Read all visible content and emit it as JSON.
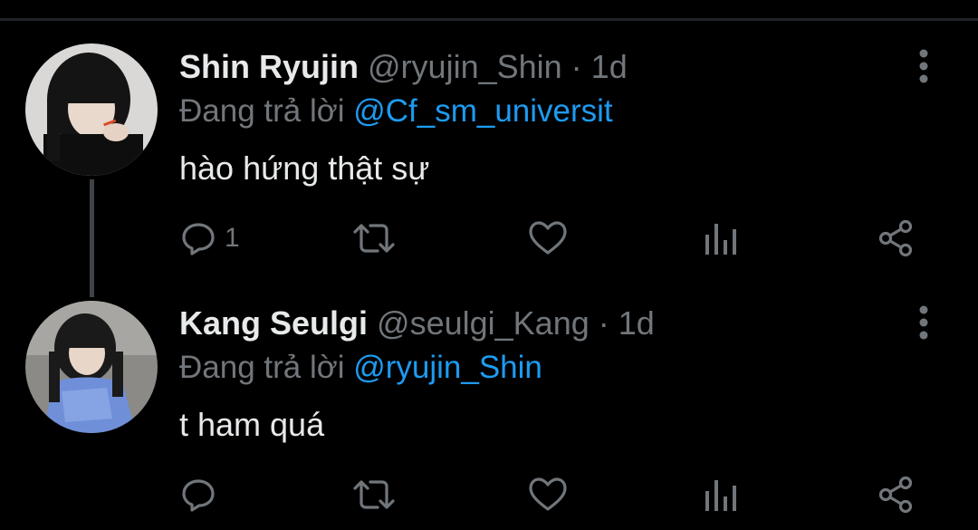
{
  "tweets": [
    {
      "name": "Shin Ryujin",
      "handle": "@ryujin_Shin",
      "separator": " · ",
      "time": "1d",
      "replying_label": "Đang trả lời ",
      "replying_to": "@Cf_sm_universit",
      "text": "hào hứng thật sự",
      "reply_count": "1"
    },
    {
      "name": "Kang Seulgi",
      "handle": "@seulgi_Kang",
      "separator": " · ",
      "time": "1d",
      "replying_label": "Đang trả lời ",
      "replying_to": "@ryujin_Shin",
      "text": "t ham quá",
      "reply_count": ""
    }
  ],
  "icons": [
    "reply-icon",
    "retweet-icon",
    "like-icon",
    "analytics-icon",
    "share-icon",
    "more-icon"
  ],
  "colors": {
    "background": "#000000",
    "name": "#e7e9ea",
    "secondary": "#71767b",
    "mention": "#1d9bf0",
    "thread_line": "#3f4346"
  }
}
